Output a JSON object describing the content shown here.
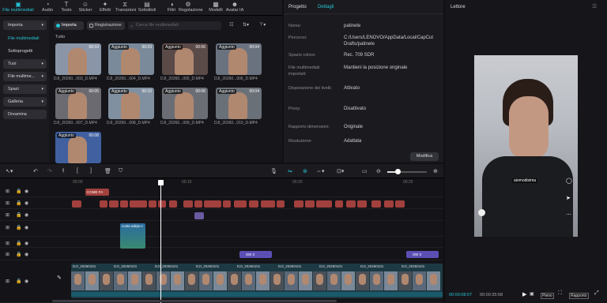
{
  "toolbar": {
    "items": [
      {
        "label": "File multimediali",
        "icon": "media-icon",
        "active": true
      },
      {
        "label": "Audio",
        "icon": "audio-icon"
      },
      {
        "label": "Testo",
        "icon": "text-icon"
      },
      {
        "label": "Sticker",
        "icon": "sticker-icon"
      },
      {
        "label": "Effetti",
        "icon": "effects-icon"
      },
      {
        "label": "Transizioni",
        "icon": "transitions-icon"
      },
      {
        "label": "Sottotitoli",
        "icon": "captions-icon"
      },
      {
        "label": "Filtri",
        "icon": "filters-icon"
      },
      {
        "label": "Regolazione",
        "icon": "adjust-icon"
      },
      {
        "label": "Modelli",
        "icon": "templates-icon"
      },
      {
        "label": "Avatar IA",
        "icon": "avatar-icon"
      }
    ]
  },
  "sidebar": {
    "items": [
      {
        "label": "Importa",
        "dropdown": true,
        "style": "box"
      },
      {
        "label": "File multimediali",
        "style": "active"
      },
      {
        "label": "Sottoprogetti",
        "style": "plain"
      },
      {
        "label": "Tuoi",
        "dropdown": true,
        "style": "box"
      },
      {
        "label": "File multime...",
        "dropdown": true,
        "style": "box"
      },
      {
        "label": "Spazi",
        "dropdown": true,
        "style": "box"
      },
      {
        "label": "Galleria",
        "dropdown": true,
        "style": "box"
      },
      {
        "label": "Dreamina",
        "style": "box"
      }
    ]
  },
  "media": {
    "import_label": "Importa",
    "record_label": "Registrazione",
    "search_placeholder": "Cerca file multimediali",
    "section_label": "Tutto",
    "items": [
      {
        "name": "DJI_20260...003_D.MP4",
        "duration": "00:10",
        "added": false
      },
      {
        "name": "DJI_20260...004_D.MP4",
        "duration": "00:23",
        "added": true
      },
      {
        "name": "DJI_20260...005_D.MP4",
        "duration": "00:06",
        "added": true
      },
      {
        "name": "DJI_20260...006_D.MP4",
        "duration": "00:04",
        "added": true
      },
      {
        "name": "DJI_20260...007_D.MP4",
        "duration": "00:05",
        "added": true
      },
      {
        "name": "DJI_20260...008_D.MP4",
        "duration": "00:10",
        "added": true
      },
      {
        "name": "DJI_20260...009_D.MP4",
        "duration": "00:06",
        "added": true
      },
      {
        "name": "DJI_20260...010_D.MP4",
        "duration": "00:04",
        "added": true
      },
      {
        "name": "",
        "duration": "00:08",
        "added": true
      }
    ],
    "added_label": "Aggiunto"
  },
  "props": {
    "tab_project": "Progetto",
    "tab_details": "Dettagli",
    "rows": [
      {
        "label": "Nome:",
        "value": "patinete"
      },
      {
        "label": "Percorso:",
        "value": "C:/Users/LENOVO/AppData/Local/CapCut Drafts/patinete"
      },
      {
        "label": "Spazio colore:",
        "value": "Rec. 709 SDR"
      },
      {
        "label": "File multimediali importati:",
        "value": "Mantieni la posizione originale"
      },
      {
        "label": "Disposizione dei livelli:",
        "value": "Attivato"
      },
      {
        "label": "Proxy:",
        "value": "Disattivato"
      },
      {
        "label": "Rapporto dimensioni:",
        "value": "Originale"
      },
      {
        "label": "Risoluzione:",
        "value": "Adattata"
      }
    ],
    "modify_label": "Modifica"
  },
  "player": {
    "title": "Lettore",
    "caption": "aiomodisima",
    "current_time": "00:00:08:07",
    "total_time": "00:00:35:58",
    "full_label": "Pieno",
    "ratio_label": "Rapporto"
  },
  "timeline": {
    "ruler": [
      "00:00",
      "00:15",
      "00:20",
      "00:25"
    ],
    "text_clip": "COME FA",
    "sticker_clip": "costa adeje.n",
    "audio_clips": [
      "SW 3",
      "SW 3"
    ],
    "video_clip_label": "DJI_20260101"
  }
}
